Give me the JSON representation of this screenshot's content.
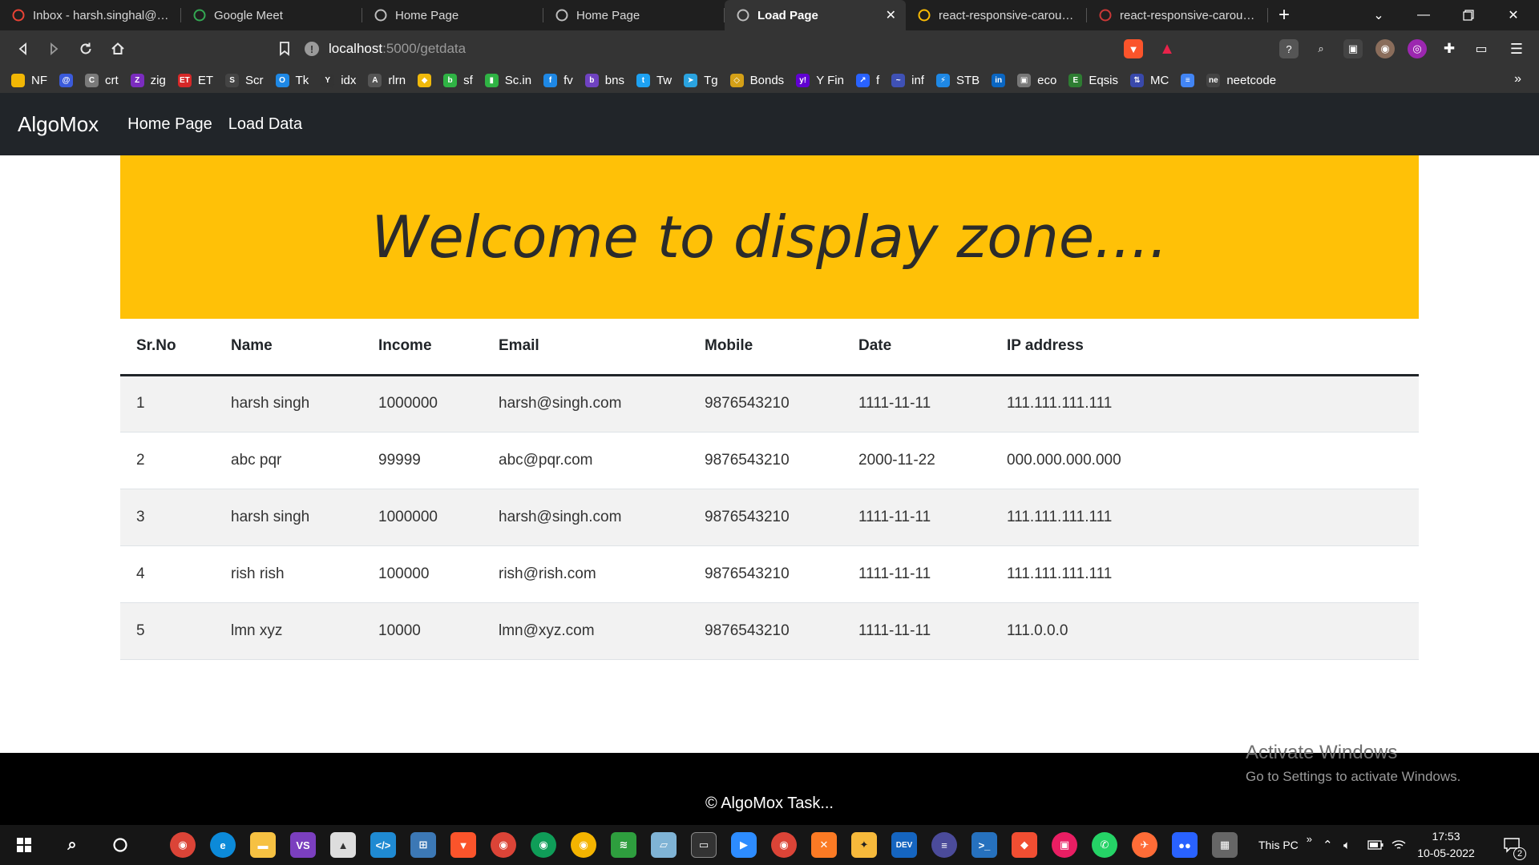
{
  "browser": {
    "tabs": [
      {
        "title": "Inbox - harsh.singhal@quar",
        "icon": "gmail-icon",
        "color": "#ea4335",
        "active": false
      },
      {
        "title": "Google Meet",
        "icon": "google-meet-icon",
        "color": "#34a853",
        "active": false
      },
      {
        "title": "Home Page",
        "icon": "globe-icon",
        "color": "#bdbdbd",
        "active": false
      },
      {
        "title": "Home Page",
        "icon": "globe-icon",
        "color": "#bdbdbd",
        "active": false
      },
      {
        "title": "Load Page",
        "icon": "globe-icon",
        "color": "#bdbdbd",
        "active": true
      },
      {
        "title": "react-responsive-carousel,",
        "icon": "loading-icon",
        "color": "#fbbc04",
        "active": false
      },
      {
        "title": "react-responsive-carousel -",
        "icon": "npm-icon",
        "color": "#cb3837",
        "active": false
      }
    ],
    "new_tab": "+",
    "url_host": "localhost",
    "url_path": ":5000/getdata",
    "bookmarks": [
      {
        "label": "NF",
        "color": "#f2b705",
        "glyph": ""
      },
      {
        "label": "",
        "color": "#3b5bdb",
        "glyph": "@"
      },
      {
        "label": "crt",
        "color": "#7a7a7a",
        "glyph": "C"
      },
      {
        "label": "zig",
        "color": "#7b2cbf",
        "glyph": "Z"
      },
      {
        "label": "ET",
        "color": "#d62828",
        "glyph": "ET"
      },
      {
        "label": "Scr",
        "color": "#444",
        "glyph": "S"
      },
      {
        "label": "Tk",
        "color": "#1e88e5",
        "glyph": "O"
      },
      {
        "label": "idx",
        "color": "#333",
        "glyph": "Y"
      },
      {
        "label": "rlrn",
        "color": "#555",
        "glyph": "A"
      },
      {
        "label": "",
        "color": "#f0b90b",
        "glyph": "◆"
      },
      {
        "label": "sf",
        "color": "#2fb344",
        "glyph": "b"
      },
      {
        "label": "Sc.in",
        "color": "#2fb344",
        "glyph": "▮"
      },
      {
        "label": "fv",
        "color": "#1e88e5",
        "glyph": "f"
      },
      {
        "label": "bns",
        "color": "#6f42c1",
        "glyph": "b"
      },
      {
        "label": "Tw",
        "color": "#1da1f2",
        "glyph": "t"
      },
      {
        "label": "Tg",
        "color": "#2aa3e0",
        "glyph": "➤"
      },
      {
        "label": "Bonds",
        "color": "#d4a017",
        "glyph": "◇"
      },
      {
        "label": "Y Fin",
        "color": "#6001d2",
        "glyph": "y!"
      },
      {
        "label": "f",
        "color": "#2962ff",
        "glyph": "↗"
      },
      {
        "label": "inf",
        "color": "#3f51b5",
        "glyph": "~"
      },
      {
        "label": "STB",
        "color": "#1e88e5",
        "glyph": "⚡"
      },
      {
        "label": "",
        "color": "#0a66c2",
        "glyph": "in"
      },
      {
        "label": "eco",
        "color": "#777",
        "glyph": "▣"
      },
      {
        "label": "Eqsis",
        "color": "#2e7d32",
        "glyph": "E"
      },
      {
        "label": "MC",
        "color": "#3949ab",
        "glyph": "⇅"
      },
      {
        "label": "",
        "color": "#4285f4",
        "glyph": "≡"
      },
      {
        "label": "neetcode",
        "color": "#444",
        "glyph": "ne"
      }
    ],
    "bookmarks_more": "»"
  },
  "app": {
    "brand": "AlgoMox",
    "nav": [
      "Home Page",
      "Load Data"
    ],
    "hero_title": "Welcome to display zone....",
    "table": {
      "headers": [
        "Sr.No",
        "Name",
        "Income",
        "Email",
        "Mobile",
        "Date",
        "IP address"
      ],
      "rows": [
        [
          "1",
          "harsh singh",
          "1000000",
          "harsh@singh.com",
          "9876543210",
          "1111-11-11",
          "111.111.111.111"
        ],
        [
          "2",
          "abc pqr",
          "99999",
          "abc@pqr.com",
          "9876543210",
          "2000-11-22",
          "000.000.000.000"
        ],
        [
          "3",
          "harsh singh",
          "1000000",
          "harsh@singh.com",
          "9876543210",
          "1111-11-11",
          "111.111.111.111"
        ],
        [
          "4",
          "rish rish",
          "100000",
          "rish@rish.com",
          "9876543210",
          "1111-11-11",
          "111.111.111.111"
        ],
        [
          "5",
          "lmn xyz",
          "10000",
          "lmn@xyz.com",
          "9876543210",
          "1111-11-11",
          "111.0.0.0"
        ]
      ]
    },
    "footer": "© AlgoMox Task..."
  },
  "windows": {
    "activate_title": "Activate Windows",
    "activate_sub": "Go to Settings to activate Windows.",
    "this_pc": "This PC",
    "time": "17:53",
    "date": "10-05-2022",
    "notification_count": "2"
  },
  "colors": {
    "hero_bg": "#ffc107",
    "navbar_bg": "#212529",
    "footer_bg": "#000000",
    "stripe": "#f2f2f2"
  }
}
